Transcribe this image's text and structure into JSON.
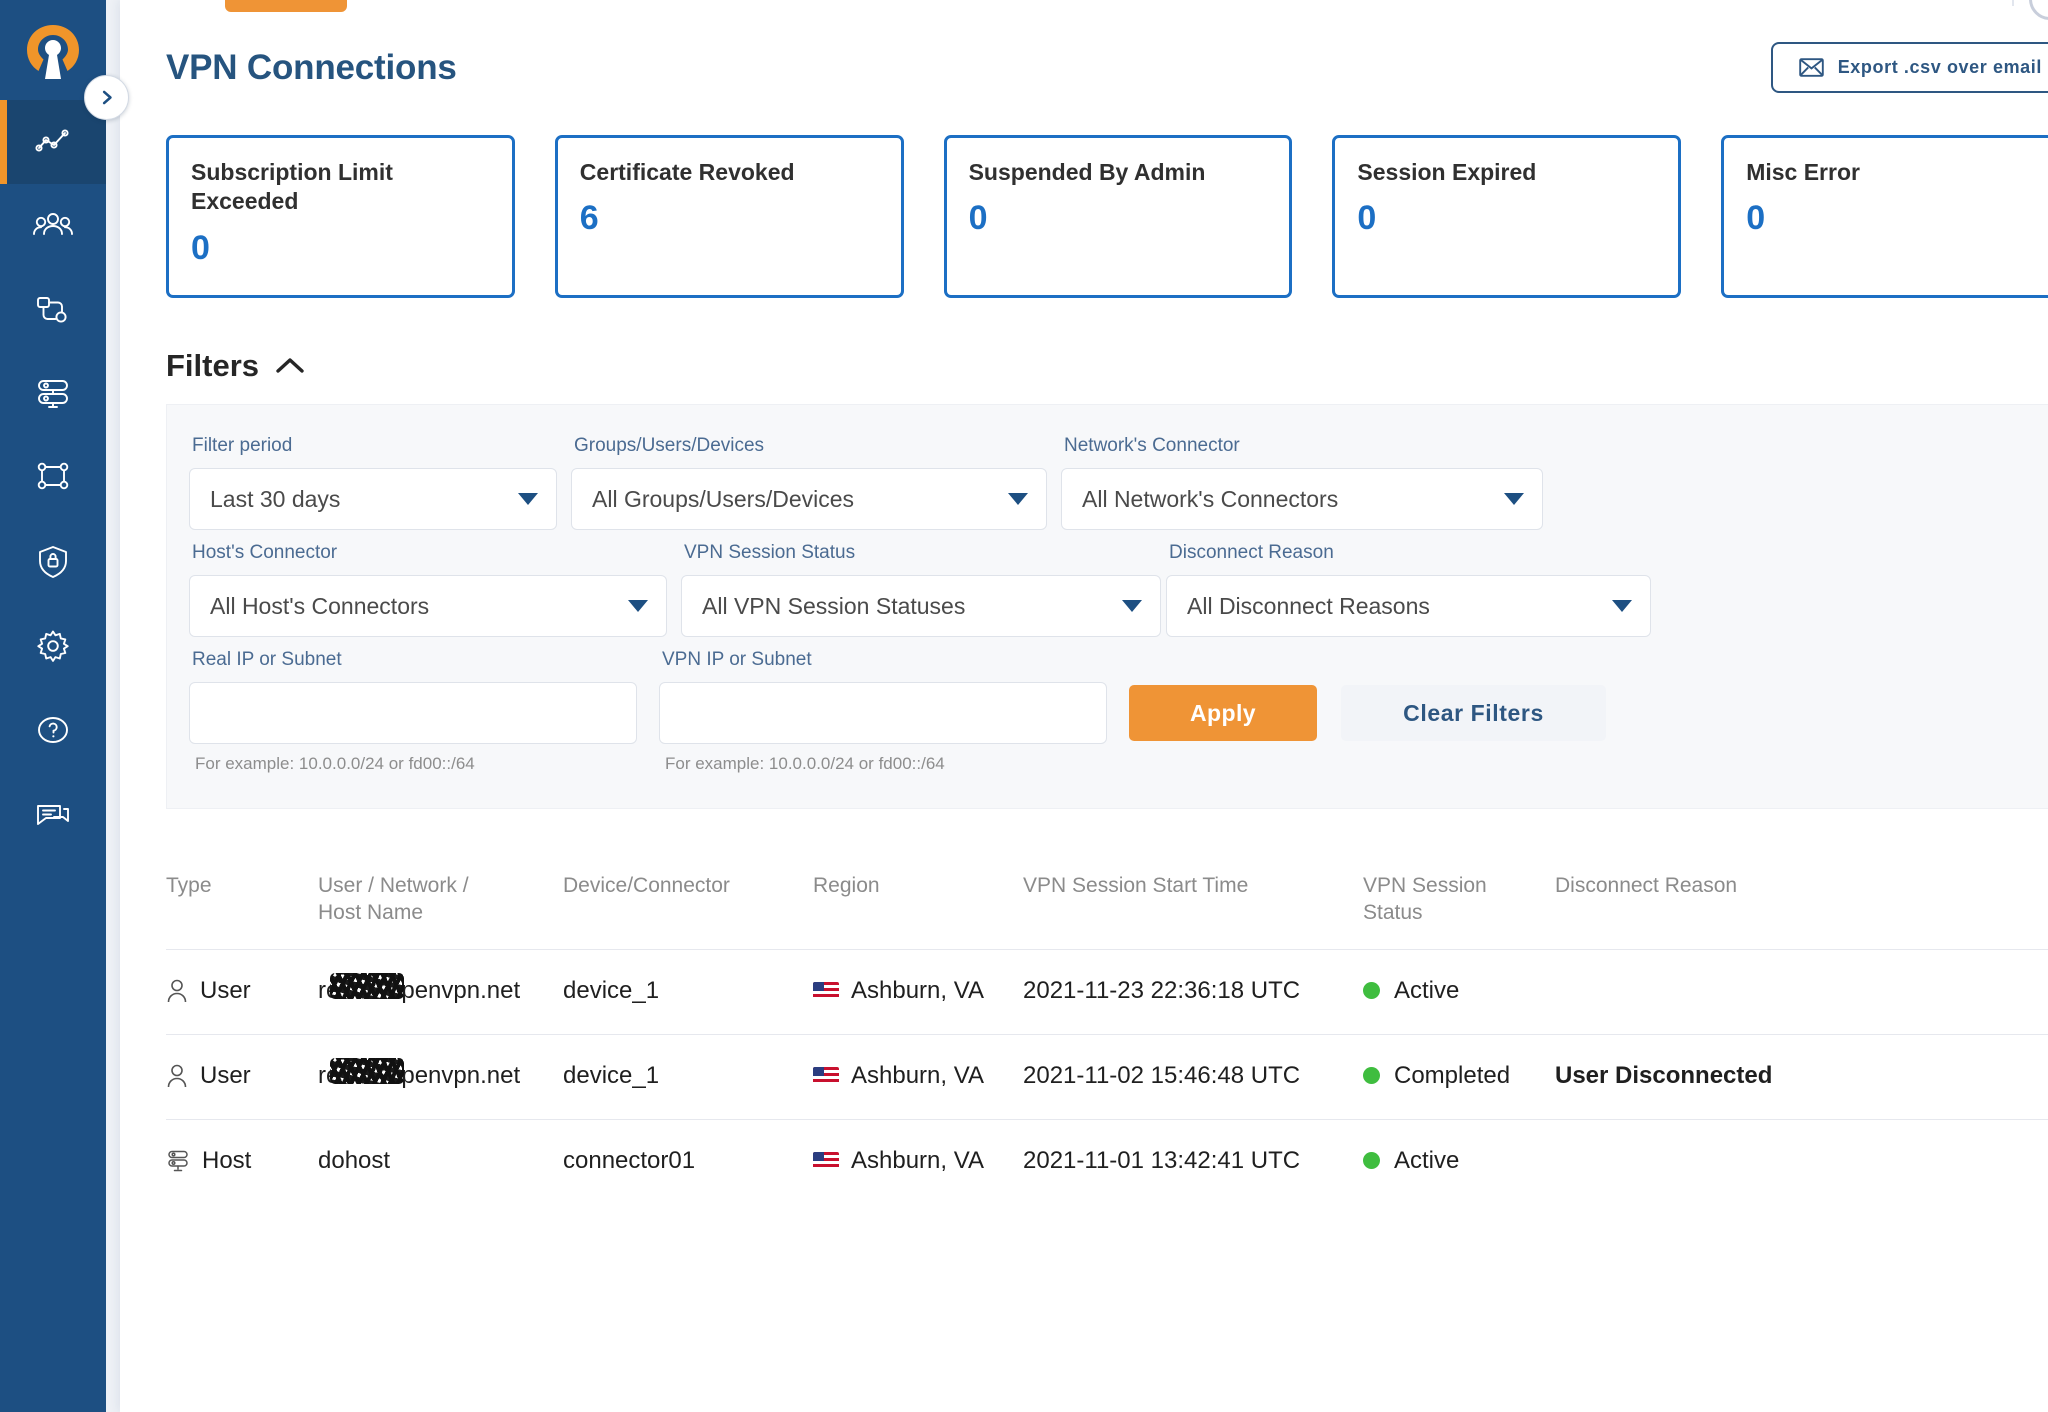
{
  "brand": {
    "logo_icon": "openvpn-logo-icon",
    "accent_orange": "#ef9436",
    "accent_blue": "#1c6fc4",
    "sidebar_bg": "#1d4f82"
  },
  "sidebar": {
    "collapse_icon": "chevron-right-icon",
    "items": [
      {
        "name": "sidebar-item-analytics",
        "icon": "line-chart-icon",
        "active": true
      },
      {
        "name": "sidebar-item-users",
        "icon": "users-group-icon",
        "active": false
      },
      {
        "name": "sidebar-item-devices",
        "icon": "device-connector-icon",
        "active": false
      },
      {
        "name": "sidebar-item-networks",
        "icon": "servers-icon",
        "active": false
      },
      {
        "name": "sidebar-item-topology",
        "icon": "network-nodes-icon",
        "active": false
      },
      {
        "name": "sidebar-item-security",
        "icon": "shield-lock-icon",
        "active": false
      },
      {
        "name": "sidebar-item-settings",
        "icon": "gear-icon",
        "active": false
      },
      {
        "name": "sidebar-item-help",
        "icon": "question-circle-icon",
        "active": false
      },
      {
        "name": "sidebar-item-support",
        "icon": "chat-messages-icon",
        "active": false
      }
    ]
  },
  "header": {
    "title": "VPN Connections",
    "export_button": {
      "label": "Export .csv over email",
      "icon": "envelope-icon"
    },
    "avatar_icon": "user-avatar-icon"
  },
  "stats": [
    {
      "title": "Subscription Limit Exceeded",
      "value": "0"
    },
    {
      "title": "Certificate Revoked",
      "value": "6"
    },
    {
      "title": "Suspended By Admin",
      "value": "0"
    },
    {
      "title": "Session Expired",
      "value": "0"
    },
    {
      "title": "Misc Error",
      "value": "0"
    }
  ],
  "filters": {
    "heading": "Filters",
    "collapse_icon": "chevron-up-icon",
    "row1": [
      {
        "label": "Filter period",
        "value": "Last 30 days"
      },
      {
        "label": "Groups/Users/Devices",
        "value": "All Groups/Users/Devices"
      },
      {
        "label": "Network's Connector",
        "value": "All Network's Connectors"
      }
    ],
    "row2": [
      {
        "label": "Host's Connector",
        "value": "All Host's Connectors"
      },
      {
        "label": "VPN Session Status",
        "value": "All VPN Session Statuses"
      },
      {
        "label": "Disconnect Reason",
        "value": "All Disconnect Reasons"
      }
    ],
    "row3": [
      {
        "label": "Real IP or Subnet",
        "value": "",
        "placeholder": "",
        "hint": "For example: 10.0.0.0/24 or fd00::/64"
      },
      {
        "label": "VPN IP or Subnet",
        "value": "",
        "placeholder": "",
        "hint": "For example: 10.0.0.0/24 or fd00::/64"
      }
    ],
    "apply_label": "Apply",
    "clear_label": "Clear Filters"
  },
  "table": {
    "columns": [
      "Type",
      "User / Network / Host Name",
      "Device/Connector",
      "Region",
      "VPN Session Start Time",
      "VPN Session Status",
      "Disconnect Reason"
    ],
    "rows": [
      {
        "type": "User",
        "type_icon": "user-icon",
        "user_prefix": "re",
        "user_suffix": "penvpn.net",
        "user_redacted": true,
        "device": "device_1",
        "region": "Ashburn, VA",
        "region_flag": "us-flag-icon",
        "start_time": "2021-11-23 22:36:18 UTC",
        "status": "Active",
        "status_color": "#3fbd3f",
        "disconnect_reason": "",
        "arrow_icon": "chevron-right-icon"
      },
      {
        "type": "User",
        "type_icon": "user-icon",
        "user_prefix": "re",
        "user_suffix": "penvpn.net",
        "user_redacted": true,
        "device": "device_1",
        "region": "Ashburn, VA",
        "region_flag": "us-flag-icon",
        "start_time": "2021-11-02 15:46:48 UTC",
        "status": "Completed",
        "status_color": "#3fbd3f",
        "disconnect_reason": "User Disconnected",
        "arrow_icon": "chevron-right-icon"
      },
      {
        "type": "Host",
        "type_icon": "server-icon",
        "user_prefix": "dohost",
        "user_suffix": "",
        "user_redacted": false,
        "device": "connector01",
        "region": "Ashburn, VA",
        "region_flag": "us-flag-icon",
        "start_time": "2021-11-01 13:42:41 UTC",
        "status": "Active",
        "status_color": "#3fbd3f",
        "disconnect_reason": "",
        "arrow_icon": "chevron-right-icon"
      }
    ]
  }
}
